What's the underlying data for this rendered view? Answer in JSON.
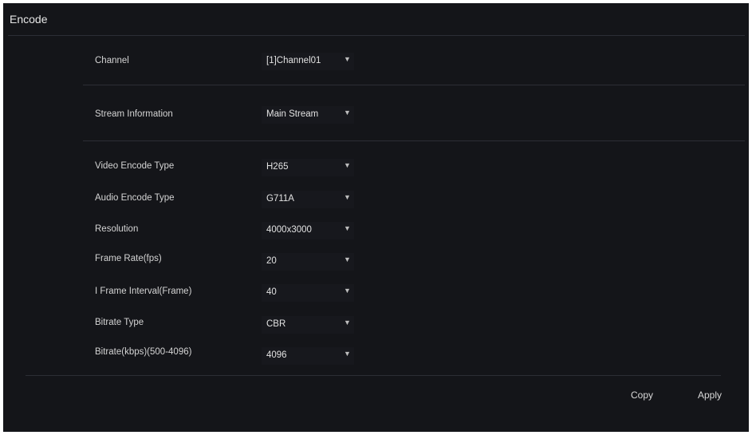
{
  "title": "Encode",
  "rows": [
    {
      "label": "Channel",
      "value": "[1]Channel01"
    },
    {
      "label": "Stream Information",
      "value": "Main Stream"
    },
    {
      "label": "Video Encode Type",
      "value": "H265"
    },
    {
      "label": "Audio Encode Type",
      "value": "G711A"
    },
    {
      "label": "Resolution",
      "value": "4000x3000"
    },
    {
      "label": "Frame Rate(fps)",
      "value": "20"
    },
    {
      "label": "I Frame Interval(Frame)",
      "value": "40"
    },
    {
      "label": "Bitrate Type",
      "value": "CBR"
    },
    {
      "label": "Bitrate(kbps)(500-4096)",
      "value": "4096"
    }
  ],
  "icons": {
    "dropdown": "chevron-down-icon"
  },
  "buttons": {
    "copy": "Copy",
    "apply": "Apply"
  },
  "colors": {
    "background": "#141519",
    "text": "#d4d4d4",
    "divider": "#2c2e35"
  }
}
